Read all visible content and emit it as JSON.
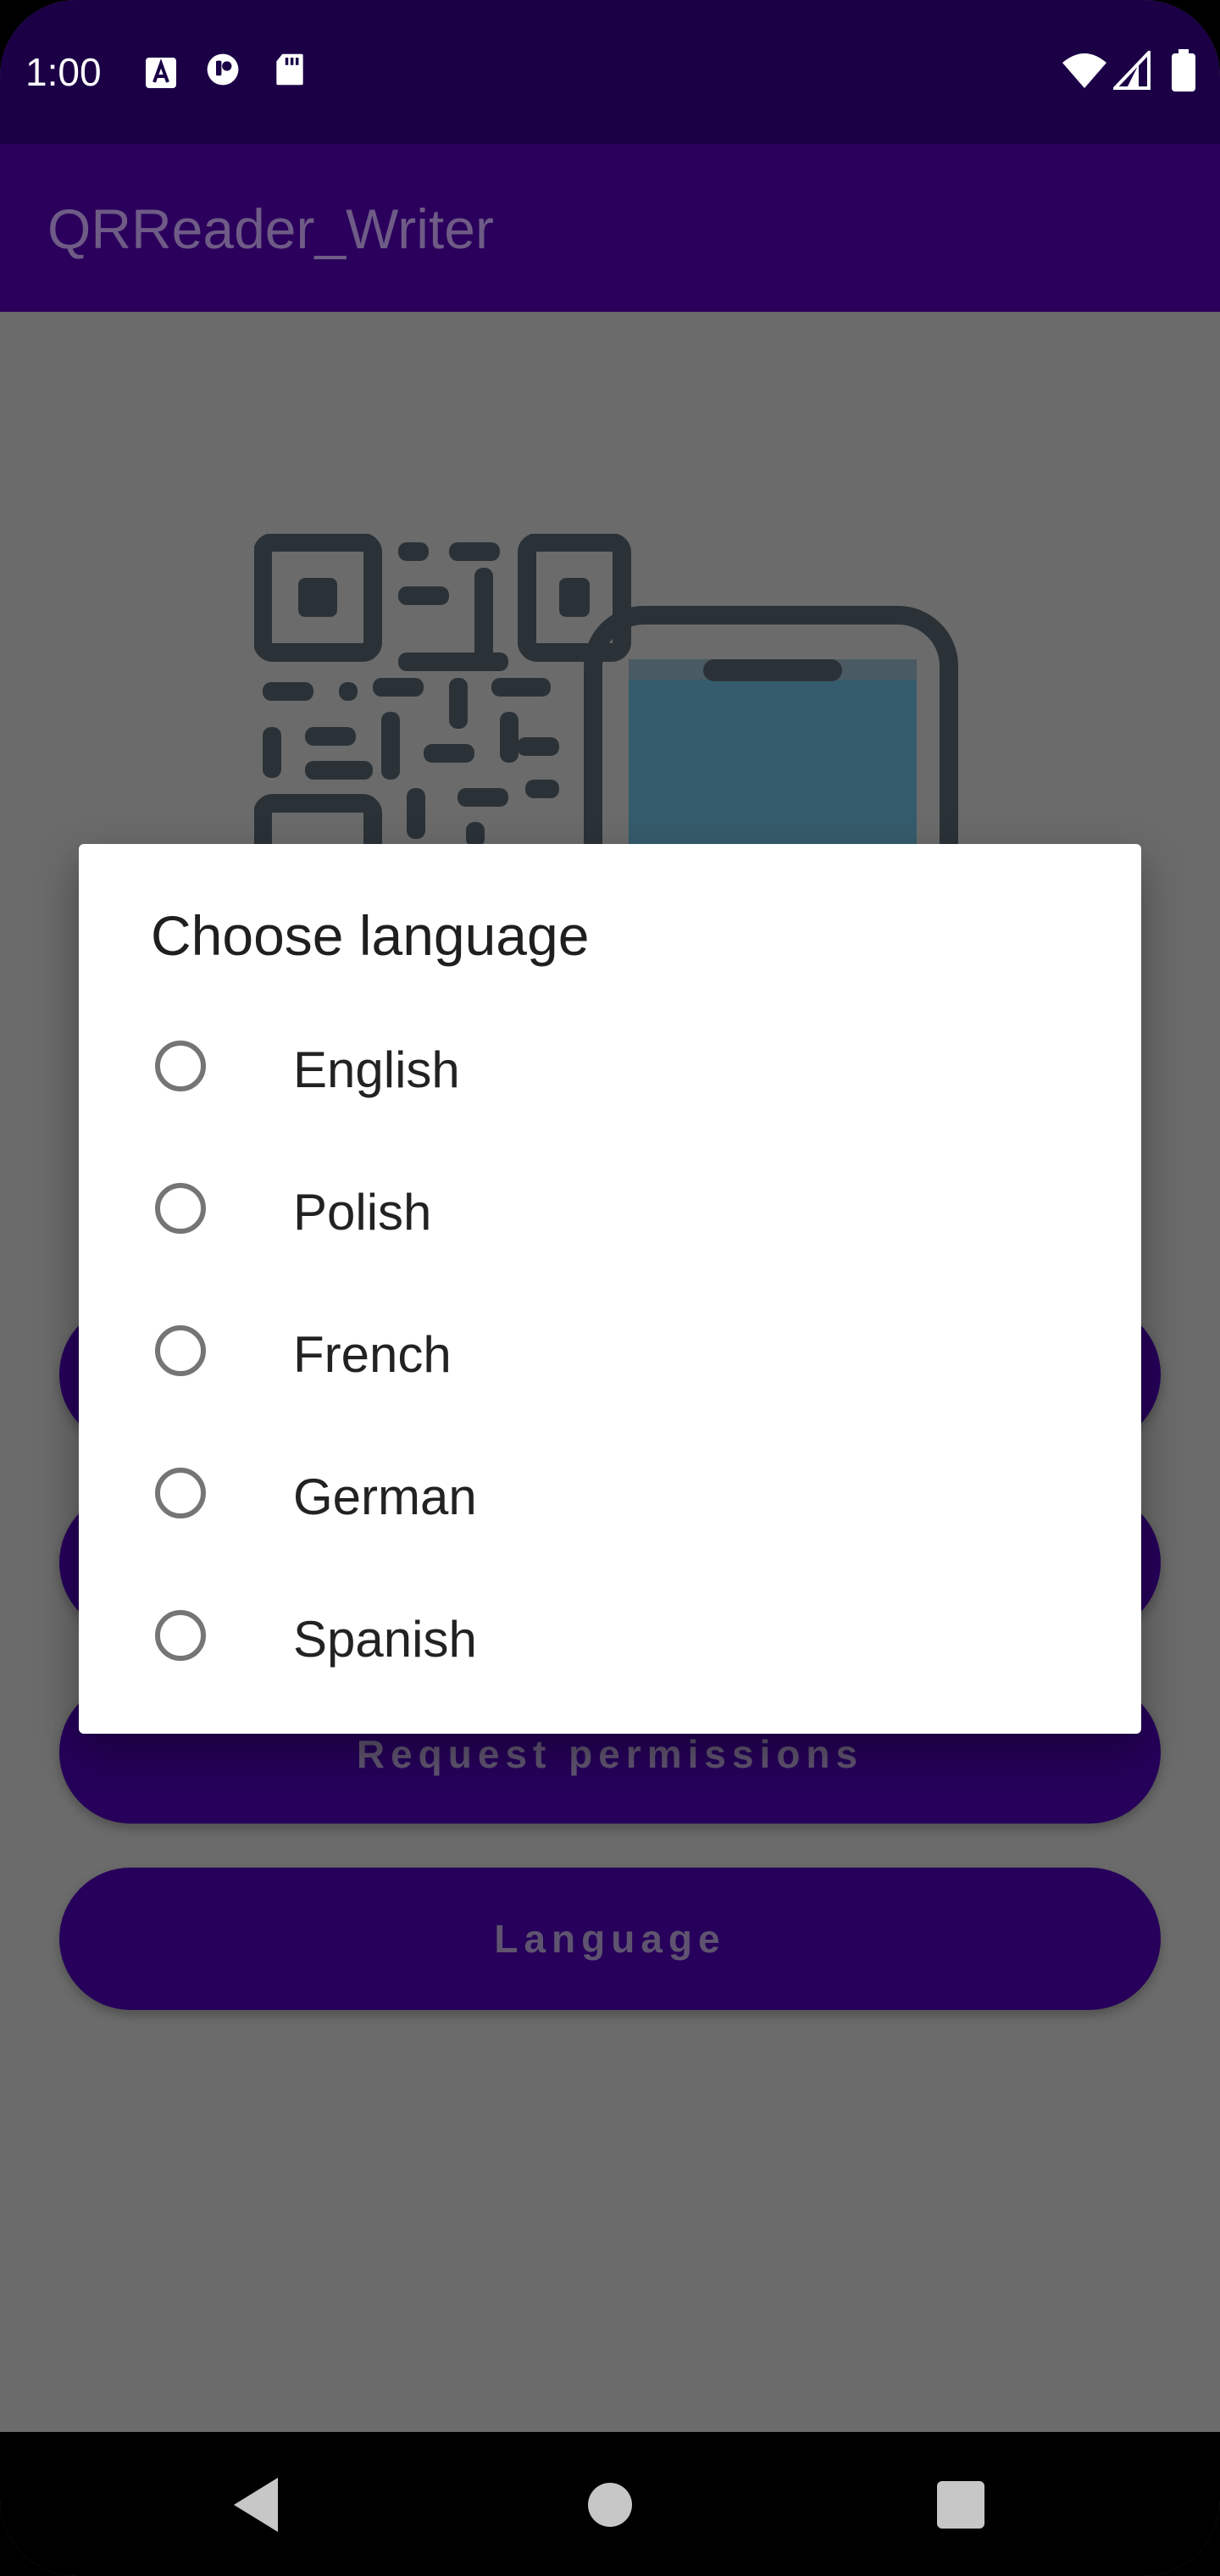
{
  "status_bar": {
    "time": "1:00",
    "icons_left": [
      "a-notification-icon",
      "media-notification-icon",
      "sd-card-icon"
    ],
    "icons_right": [
      "wifi-icon",
      "signal-icon",
      "battery-icon"
    ]
  },
  "app_bar": {
    "title": "QRReader_Writer"
  },
  "illustration": {
    "icon": "qr-code-phone-illustration"
  },
  "buttons": {
    "request_permissions": "Request permissions",
    "language": "Language"
  },
  "dialog": {
    "title": "Choose language",
    "options": [
      {
        "label": "English",
        "selected": false
      },
      {
        "label": "Polish",
        "selected": false
      },
      {
        "label": "French",
        "selected": false
      },
      {
        "label": "German",
        "selected": false
      },
      {
        "label": "Spanish",
        "selected": false
      }
    ]
  },
  "colors": {
    "status_bar": "#1b0046",
    "app_bar": "#2a005c",
    "button": "#26005a",
    "scrim": "#6b6b6b",
    "dialog": "#ffffff"
  }
}
